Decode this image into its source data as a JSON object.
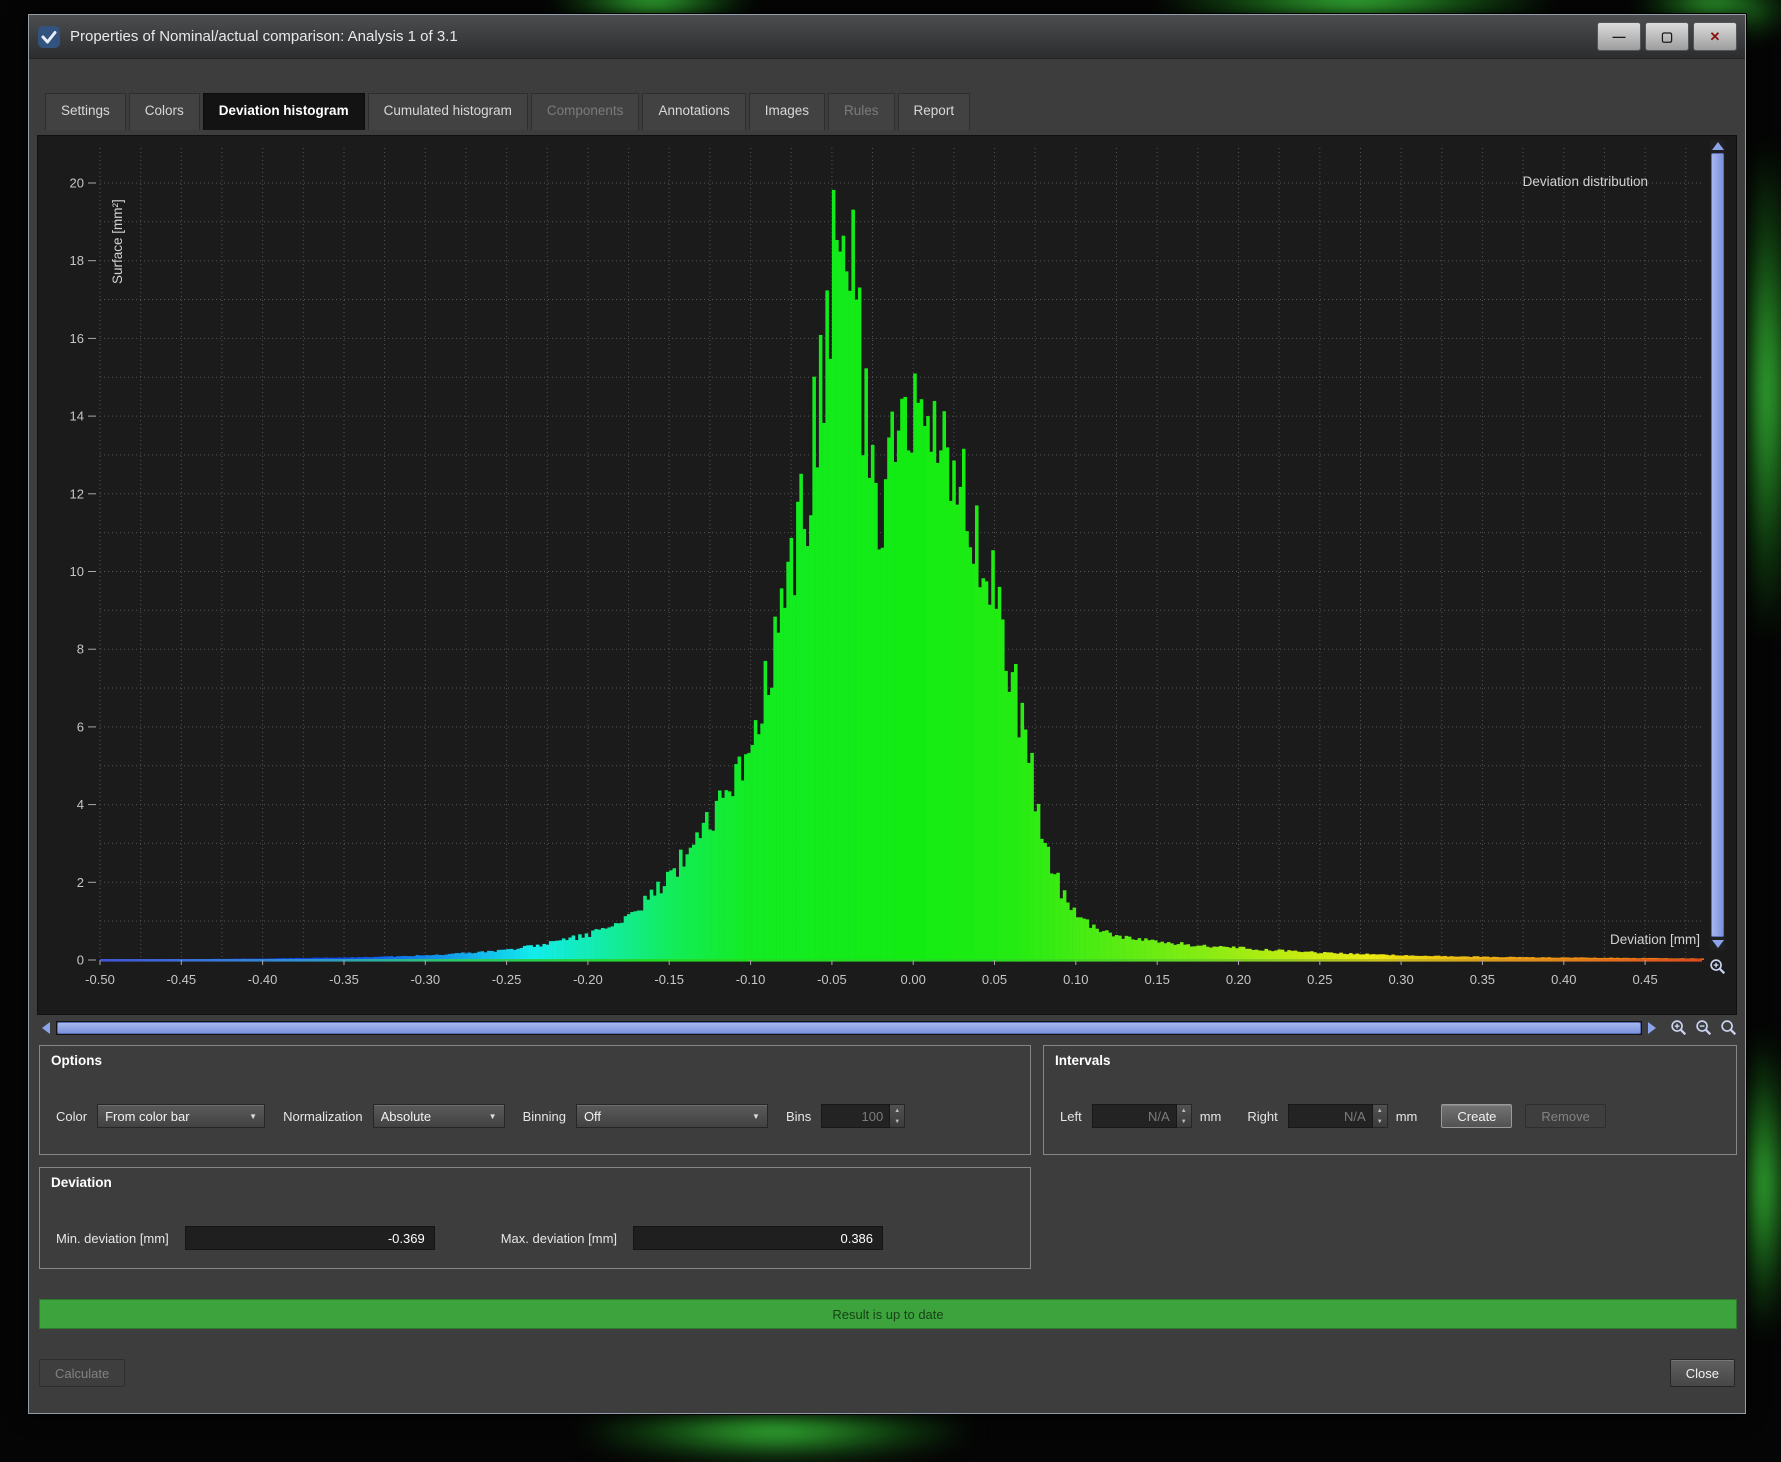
{
  "window": {
    "title": "Properties of Nominal/actual comparison: Analysis 1 of 3.1"
  },
  "icons": {
    "minimize": "—",
    "maximize": "▢",
    "close": "✕",
    "chevron_down": "▼",
    "spin_up": "▲",
    "spin_down": "▼"
  },
  "tabs": [
    {
      "label": "Settings",
      "state": "normal"
    },
    {
      "label": "Colors",
      "state": "normal"
    },
    {
      "label": "Deviation histogram",
      "state": "active"
    },
    {
      "label": "Cumulated histogram",
      "state": "normal"
    },
    {
      "label": "Components",
      "state": "disabled"
    },
    {
      "label": "Annotations",
      "state": "normal"
    },
    {
      "label": "Images",
      "state": "normal"
    },
    {
      "label": "Rules",
      "state": "disabled"
    },
    {
      "label": "Report",
      "state": "normal"
    }
  ],
  "chart_data": {
    "type": "bar",
    "title": "Deviation distribution",
    "xlabel": "Deviation [mm]",
    "ylabel": "Surface [mm²]",
    "xlim": [
      -0.5,
      0.485
    ],
    "ylim": [
      0,
      20.9
    ],
    "x_ticks": [
      -0.5,
      -0.45,
      -0.4,
      -0.35,
      -0.3,
      -0.25,
      -0.2,
      -0.15,
      -0.1,
      -0.05,
      0,
      0.05,
      0.1,
      0.15,
      0.2,
      0.25,
      0.3,
      0.35,
      0.4,
      0.45
    ],
    "y_ticks": [
      0,
      2,
      4,
      6,
      8,
      10,
      12,
      14,
      16,
      18,
      20
    ],
    "grid": true,
    "bar_step": 0.002,
    "peaks": [
      {
        "x": -0.043,
        "y": 19.6
      },
      {
        "x": 0.002,
        "y": 14.5
      }
    ],
    "profile": [
      [
        -0.5,
        0
      ],
      [
        -0.45,
        0.02
      ],
      [
        -0.4,
        0.04
      ],
      [
        -0.36,
        0.06
      ],
      [
        -0.32,
        0.09
      ],
      [
        -0.29,
        0.14
      ],
      [
        -0.26,
        0.22
      ],
      [
        -0.24,
        0.32
      ],
      [
        -0.22,
        0.45
      ],
      [
        -0.2,
        0.65
      ],
      [
        -0.185,
        0.9
      ],
      [
        -0.17,
        1.3
      ],
      [
        -0.155,
        1.9
      ],
      [
        -0.14,
        2.7
      ],
      [
        -0.125,
        3.6
      ],
      [
        -0.11,
        4.7
      ],
      [
        -0.1,
        5.7
      ],
      [
        -0.09,
        7.0
      ],
      [
        -0.08,
        8.7
      ],
      [
        -0.07,
        10.8
      ],
      [
        -0.062,
        13.0
      ],
      [
        -0.055,
        15.4
      ],
      [
        -0.05,
        17.6
      ],
      [
        -0.046,
        19.2
      ],
      [
        -0.043,
        19.6
      ],
      [
        -0.04,
        18.8
      ],
      [
        -0.036,
        17.0
      ],
      [
        -0.032,
        15.0
      ],
      [
        -0.028,
        13.4
      ],
      [
        -0.024,
        12.5
      ],
      [
        -0.02,
        12.0
      ],
      [
        -0.016,
        12.2
      ],
      [
        -0.012,
        12.9
      ],
      [
        -0.007,
        13.8
      ],
      [
        -0.002,
        14.4
      ],
      [
        0.002,
        14.5
      ],
      [
        0.006,
        14.1
      ],
      [
        0.01,
        13.6
      ],
      [
        0.015,
        13.1
      ],
      [
        0.02,
        12.8
      ],
      [
        0.026,
        12.5
      ],
      [
        0.032,
        12.0
      ],
      [
        0.038,
        11.2
      ],
      [
        0.044,
        10.3
      ],
      [
        0.05,
        9.2
      ],
      [
        0.056,
        8.2
      ],
      [
        0.062,
        7.0
      ],
      [
        0.068,
        5.8
      ],
      [
        0.074,
        4.5
      ],
      [
        0.08,
        3.2
      ],
      [
        0.086,
        2.3
      ],
      [
        0.092,
        1.7
      ],
      [
        0.1,
        1.15
      ],
      [
        0.11,
        0.85
      ],
      [
        0.12,
        0.68
      ],
      [
        0.135,
        0.55
      ],
      [
        0.15,
        0.47
      ],
      [
        0.17,
        0.4
      ],
      [
        0.19,
        0.34
      ],
      [
        0.21,
        0.28
      ],
      [
        0.24,
        0.21
      ],
      [
        0.27,
        0.16
      ],
      [
        0.3,
        0.12
      ],
      [
        0.34,
        0.09
      ],
      [
        0.38,
        0.07
      ],
      [
        0.42,
        0.06
      ],
      [
        0.45,
        0.05
      ],
      [
        0.485,
        0.04
      ]
    ],
    "hue_stops": [
      [
        -0.5,
        230
      ],
      [
        -0.35,
        225
      ],
      [
        -0.28,
        200
      ],
      [
        -0.2,
        165
      ],
      [
        -0.15,
        140
      ],
      [
        -0.1,
        124
      ],
      [
        0,
        120
      ],
      [
        0.06,
        116
      ],
      [
        0.12,
        102
      ],
      [
        0.18,
        88
      ],
      [
        0.24,
        70
      ],
      [
        0.3,
        55
      ],
      [
        0.38,
        38
      ],
      [
        0.485,
        25
      ]
    ],
    "axis_gradient": [
      {
        "pos": 0,
        "color": "#4253d8"
      },
      {
        "pos": 0.12,
        "color": "#2f8fd8"
      },
      {
        "pos": 0.22,
        "color": "#2bc86a"
      },
      {
        "pos": 0.35,
        "color": "#23dc23"
      },
      {
        "pos": 0.55,
        "color": "#23dc23"
      },
      {
        "pos": 0.68,
        "color": "#66d424"
      },
      {
        "pos": 0.8,
        "color": "#c8c01e"
      },
      {
        "pos": 0.9,
        "color": "#e08a1e"
      },
      {
        "pos": 1,
        "color": "#e0481e"
      }
    ]
  },
  "options": {
    "title": "Options",
    "color_label": "Color",
    "color_value": "From color bar",
    "normalization_label": "Normalization",
    "normalization_value": "Absolute",
    "binning_label": "Binning",
    "binning_value": "Off",
    "bins_label": "Bins",
    "bins_value": "100"
  },
  "intervals": {
    "title": "Intervals",
    "left_label": "Left",
    "left_value": "N/A",
    "left_unit": "mm",
    "right_label": "Right",
    "right_value": "N/A",
    "right_unit": "mm",
    "create_label": "Create",
    "remove_label": "Remove"
  },
  "deviation": {
    "title": "Deviation",
    "min_label": "Min. deviation [mm]",
    "min_value": "-0.369",
    "max_label": "Max. deviation [mm]",
    "max_value": "0.386"
  },
  "status": {
    "text": "Result is up to date",
    "color": "#3da43d"
  },
  "buttons": {
    "calculate": "Calculate",
    "close": "Close"
  }
}
